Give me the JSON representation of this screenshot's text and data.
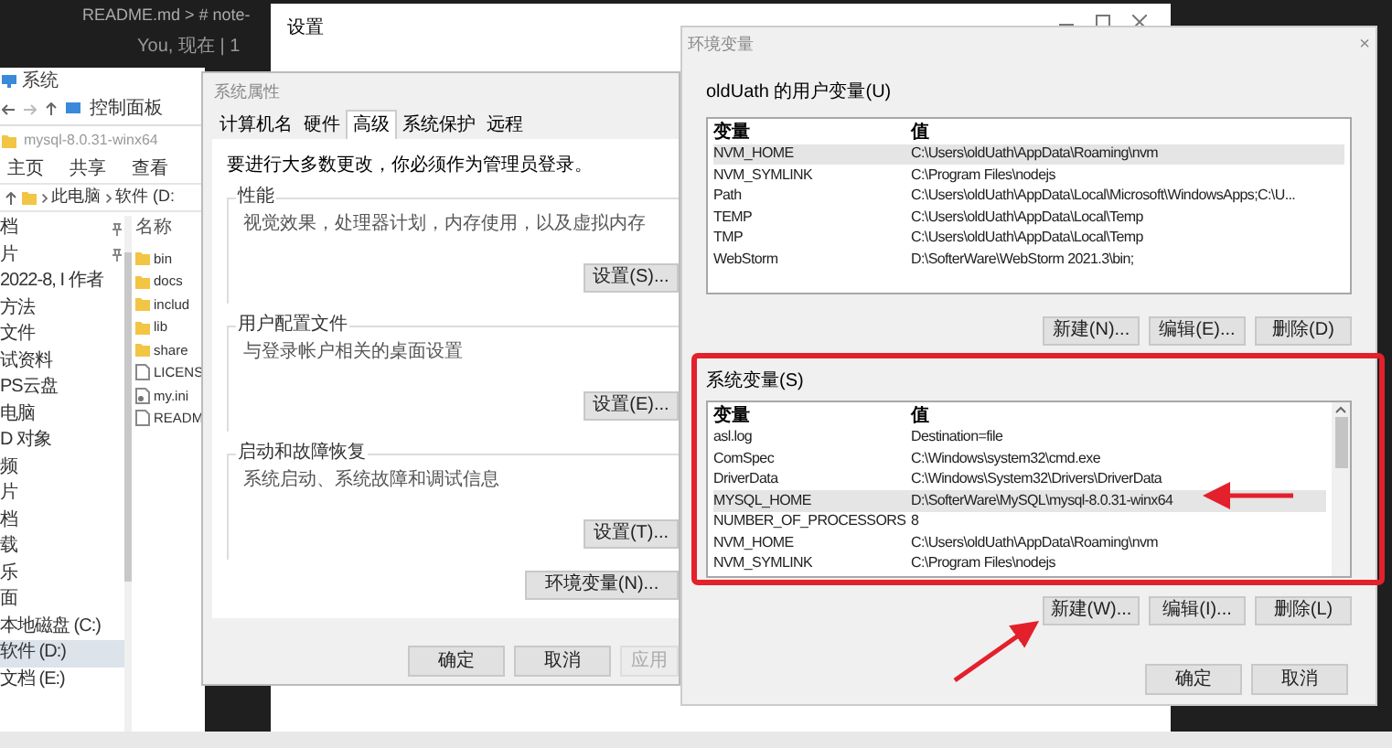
{
  "editor": {
    "breadcrumb": "README.md > # note-",
    "blame": "You, 现在 | 1"
  },
  "settings_window": {
    "title": "设置"
  },
  "explorer": {
    "title": "系统",
    "location": "控制面板",
    "folder_title": "mysql-8.0.31-winx64",
    "ribbon_tabs": [
      "主页",
      "共享",
      "查看"
    ],
    "path": [
      "此电脑",
      "软件 (D:"
    ],
    "name_column": "名称",
    "sidebar": [
      {
        "label": "档",
        "pinned": true,
        "selected": false
      },
      {
        "label": "片",
        "pinned": true,
        "selected": false
      },
      {
        "label": "2022-8, I 作者",
        "pinned": false,
        "selected": false
      },
      {
        "label": "方法",
        "pinned": false,
        "selected": false
      },
      {
        "label": "文件",
        "pinned": false,
        "selected": false
      },
      {
        "label": "试资料",
        "pinned": false,
        "selected": false
      },
      {
        "label": "PS云盘",
        "pinned": false,
        "selected": false
      },
      {
        "label": "电脑",
        "pinned": false,
        "selected": false
      },
      {
        "label": "D 对象",
        "pinned": false,
        "selected": false
      },
      {
        "label": "频",
        "pinned": false,
        "selected": false
      },
      {
        "label": "片",
        "pinned": false,
        "selected": false
      },
      {
        "label": "档",
        "pinned": false,
        "selected": false
      },
      {
        "label": "载",
        "pinned": false,
        "selected": false
      },
      {
        "label": "乐",
        "pinned": false,
        "selected": false
      },
      {
        "label": "面",
        "pinned": false,
        "selected": false
      },
      {
        "label": "本地磁盘 (C:)",
        "pinned": false,
        "selected": false
      },
      {
        "label": "软件 (D:)",
        "pinned": false,
        "selected": true
      },
      {
        "label": "文档 (E:)",
        "pinned": false,
        "selected": false
      }
    ],
    "files": [
      {
        "name": "bin",
        "kind": "folder"
      },
      {
        "name": "docs",
        "kind": "folder"
      },
      {
        "name": "includ",
        "kind": "folder"
      },
      {
        "name": "lib",
        "kind": "folder"
      },
      {
        "name": "share",
        "kind": "folder"
      },
      {
        "name": "LICENS",
        "kind": "file"
      },
      {
        "name": "my.ini",
        "kind": "settings"
      },
      {
        "name": "READM",
        "kind": "file"
      }
    ]
  },
  "system_properties": {
    "title": "系统属性",
    "tabs": [
      {
        "label": "计算机名",
        "selected": false
      },
      {
        "label": "硬件",
        "selected": false
      },
      {
        "label": "高级",
        "selected": true
      },
      {
        "label": "系统保护",
        "selected": false
      },
      {
        "label": "远程",
        "selected": false
      }
    ],
    "notice": "要进行大多数更改，你必须作为管理员登录。",
    "groups": [
      {
        "title": "性能",
        "description": "视觉效果，处理器计划，内存使用，以及虚拟内存",
        "button": "设置(S)..."
      },
      {
        "title": "用户配置文件",
        "description": "与登录帐户相关的桌面设置",
        "button": "设置(E)..."
      },
      {
        "title": "启动和故障恢复",
        "description": "系统启动、系统故障和调试信息",
        "button": "设置(T)..."
      }
    ],
    "env_button": "环境变量(N)...",
    "buttons": [
      {
        "label": "确定",
        "disabled": false
      },
      {
        "label": "取消",
        "disabled": false
      },
      {
        "label": "应用",
        "disabled": true
      }
    ]
  },
  "env_vars": {
    "title": "环境变量",
    "close": "×",
    "user_section": {
      "title": "oldUath 的用户变量(U)",
      "columns": [
        "变量",
        "值"
      ],
      "rows": [
        {
          "name": "NVM_HOME",
          "value": "C:\\Users\\oldUath\\AppData\\Roaming\\nvm",
          "selected": true
        },
        {
          "name": "NVM_SYMLINK",
          "value": "C:\\Program Files\\nodejs",
          "selected": false
        },
        {
          "name": "Path",
          "value": "C:\\Users\\oldUath\\AppData\\Local\\Microsoft\\WindowsApps;C:\\U...",
          "selected": false
        },
        {
          "name": "TEMP",
          "value": "C:\\Users\\oldUath\\AppData\\Local\\Temp",
          "selected": false
        },
        {
          "name": "TMP",
          "value": "C:\\Users\\oldUath\\AppData\\Local\\Temp",
          "selected": false
        },
        {
          "name": "WebStorm",
          "value": "D:\\SofterWare\\WebStorm 2021.3\\bin;",
          "selected": false
        }
      ],
      "buttons": [
        "新建(N)...",
        "编辑(E)...",
        "删除(D)"
      ]
    },
    "system_section": {
      "title": "系统变量(S)",
      "columns": [
        "变量",
        "值"
      ],
      "rows": [
        {
          "name": "asl.log",
          "value": "Destination=file",
          "selected": false
        },
        {
          "name": "ComSpec",
          "value": "C:\\Windows\\system32\\cmd.exe",
          "selected": false
        },
        {
          "name": "DriverData",
          "value": "C:\\Windows\\System32\\Drivers\\DriverData",
          "selected": false
        },
        {
          "name": "MYSQL_HOME",
          "value": "D:\\SofterWare\\MySQL\\mysql-8.0.31-winx64",
          "selected": true
        },
        {
          "name": "NUMBER_OF_PROCESSORS",
          "value": "8",
          "selected": false
        },
        {
          "name": "NVM_HOME",
          "value": "C:\\Users\\oldUath\\AppData\\Roaming\\nvm",
          "selected": false
        },
        {
          "name": "NVM_SYMLINK",
          "value": "C:\\Program Files\\nodejs",
          "selected": false
        }
      ],
      "buttons": [
        "新建(W)...",
        "编辑(I)...",
        "删除(L)"
      ]
    },
    "buttons": [
      "确定",
      "取消"
    ]
  }
}
